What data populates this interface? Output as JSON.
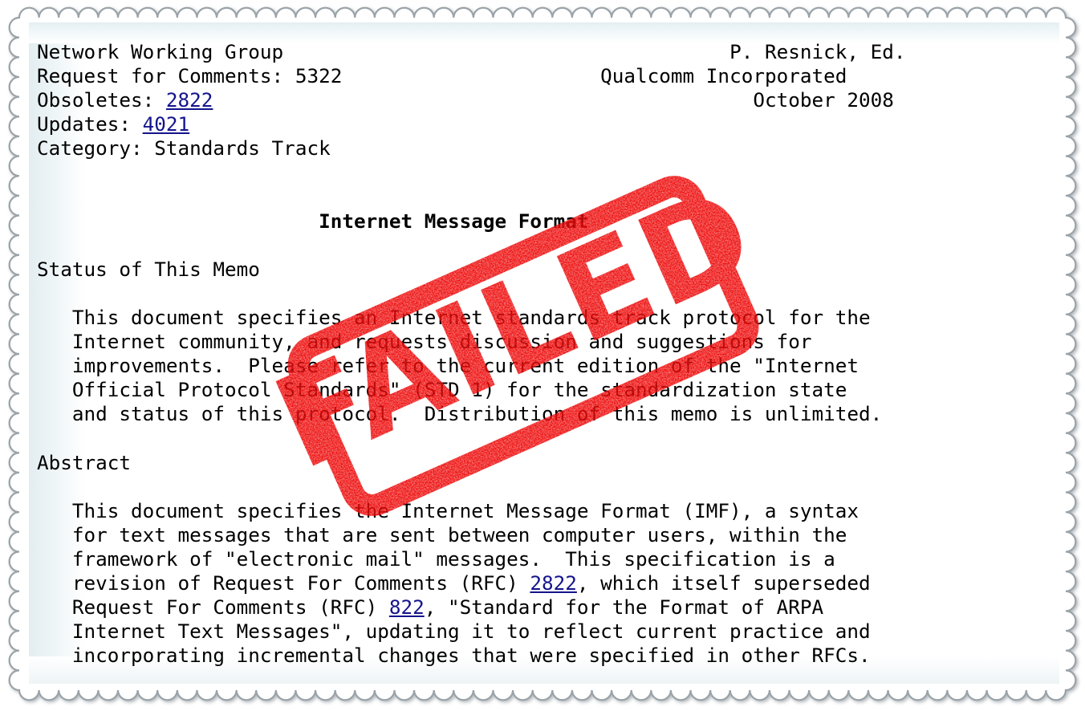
{
  "document": {
    "type": "rfc-text-document",
    "header_left": [
      "Network Working Group",
      "Request for Comments: 5322",
      "Obsoletes: ",
      "Updates: ",
      "Category: Standards Track"
    ],
    "header_right": [
      "P. Resnick, Ed.",
      "Qualcomm Incorporated",
      "October 2008"
    ],
    "working_group": "Network Working Group",
    "request_for_comments": "Request for Comments: 5322",
    "obsoletes_label": "Obsoletes: ",
    "obsoletes_value": "2822",
    "updates_label": "Updates: ",
    "updates_value": "4021",
    "category": "Category: Standards Track",
    "author": "P. Resnick, Ed.",
    "organization": "Qualcomm Incorporated",
    "date": "October 2008",
    "title": "Internet Message Format",
    "sections": [
      {
        "heading": "Status of This Memo",
        "body": "   This document specifies an Internet standards track protocol for the\n   Internet community, and requests discussion and suggestions for\n   improvements.  Please refer to the current edition of the \"Internet\n   Official Protocol Standards\" (STD 1) for the standardization state\n   and status of this protocol.  Distribution of this memo is unlimited."
      },
      {
        "heading": "Abstract",
        "body_pre": "   This document specifies the Internet Message Format (IMF), a syntax\n   for text messages that are sent between computer users, within the\n   framework of \"electronic mail\" messages.  This specification is a\n   revision of Request For Comments (RFC) ",
        "link_2822": "2822",
        "body_mid": ", which itself superseded\n   Request For Comments (RFC) ",
        "link_822": "822",
        "body_post": ", \"Standard for the Format of ARPA\n   Internet Text Messages\", updating it to reflect current practice and\n   incorporating incremental changes that were specified in other RFCs."
      }
    ],
    "links": {
      "obsoletes": "2822",
      "updates": "4021",
      "abstract_rfc_2822": "2822",
      "abstract_rfc_822": "822",
      "link_color": "#14148c"
    }
  },
  "overlay": {
    "stamp_text": "FAILED",
    "stamp_color": "#ee1111",
    "stamp_rotation_degrees": -24
  },
  "frame": {
    "style": "postage-stamp-perforated-border",
    "paper_color": "#ffffff",
    "perforation_count_top": 28,
    "perforation_count_side": 18,
    "border_color": "#9aa3a8",
    "tint_color": "#e3edf0"
  }
}
